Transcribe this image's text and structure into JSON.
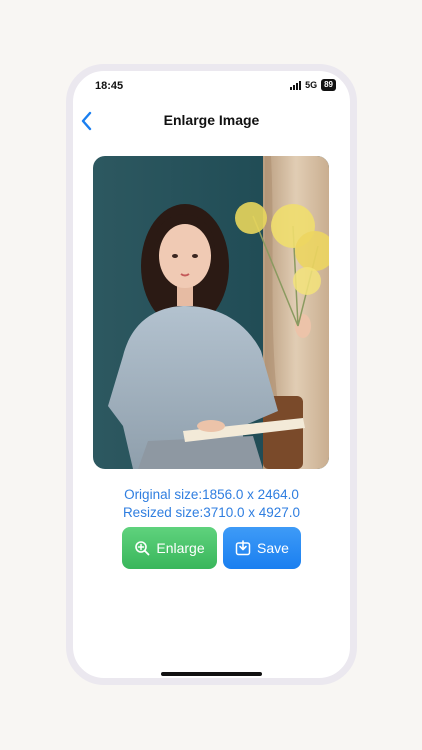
{
  "status": {
    "time": "18:45",
    "network": "5G",
    "battery": "89"
  },
  "header": {
    "title": "Enlarge Image",
    "back_icon": "chevron-left-icon"
  },
  "image": {
    "description_icon": "photo-portrait"
  },
  "info": {
    "original_size": "Original size:1856.0 x 2464.0",
    "resized_size": "Resized size:3710.0 x 4927.0"
  },
  "actions": {
    "enlarge_label": "Enlarge",
    "save_label": "Save"
  },
  "colors": {
    "accent_blue": "#2f7ee0",
    "enlarge_green": "#46c266",
    "save_blue": "#2188f3"
  }
}
